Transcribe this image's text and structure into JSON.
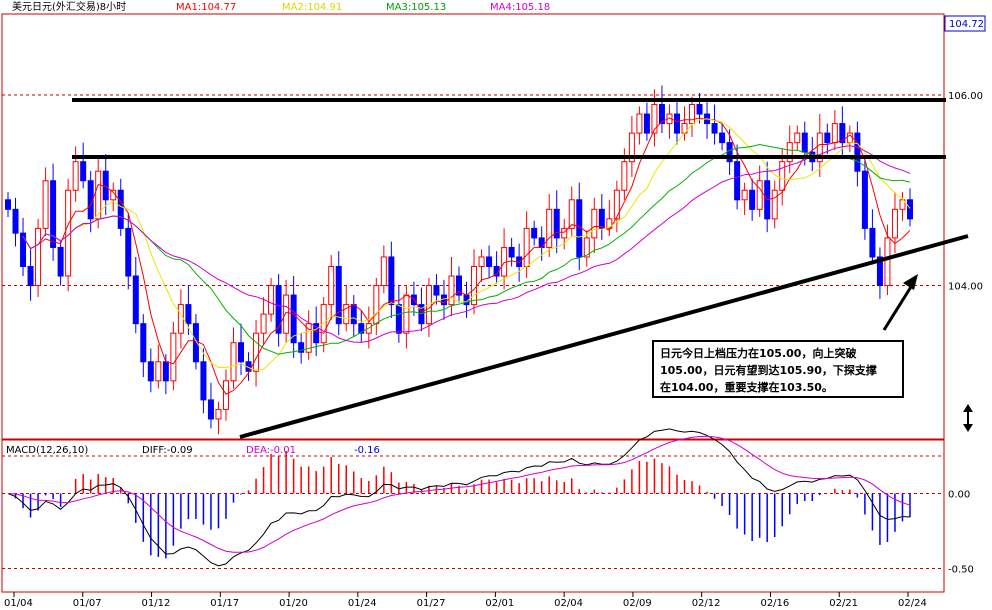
{
  "header": {
    "title": "美元日元(外汇交易)8小时",
    "ma": [
      {
        "label": "MA1:104.77",
        "color": "#ff0000"
      },
      {
        "label": "MA2:104.91",
        "color": "#e8e800"
      },
      {
        "label": "MA3:105.13",
        "color": "#00b000"
      },
      {
        "label": "MA4:105.18",
        "color": "#d000d0"
      }
    ]
  },
  "macd_header": {
    "name": "MACD(12,26,10)",
    "diff": "DIFF:-0.09",
    "dea": "DEA:-0.01",
    "macd": "-0.16"
  },
  "price_axis": {
    "current": "104.72",
    "labels": [
      {
        "text": "106.00",
        "value": 106.0
      },
      {
        "text": "104.00",
        "value": 104.0
      }
    ]
  },
  "macd_axis": {
    "labels": [
      {
        "text": "0.00",
        "value": 0.0
      },
      {
        "text": "-0.50",
        "value": -0.5
      }
    ]
  },
  "x_axis": {
    "labels": [
      "01/04",
      "01/07",
      "01/12",
      "01/17",
      "01/20",
      "01/24",
      "01/27",
      "02/01",
      "02/04",
      "02/09",
      "02/12",
      "02/16",
      "02/21",
      "02/24"
    ]
  },
  "annotation": {
    "lines": [
      "日元今日上档压力在105.00，向上突破",
      "105.00，日元有望到达105.90，下探支撑",
      "在104.00，重要支撑在103.50。"
    ]
  },
  "colors": {
    "up": "#ff0000",
    "down": "#0000ff",
    "ma1": "#ff0000",
    "ma2": "#e8e800",
    "ma3": "#00b000",
    "ma4": "#d000d0",
    "diff": "#000000",
    "dea": "#d000d0",
    "grid": "#cc0000"
  },
  "chart_data": {
    "type": "candlestick",
    "price_range": [
      102.4,
      106.85
    ],
    "macd_range": [
      -0.65,
      0.35
    ],
    "resistance_levels": [
      106.0,
      105.1
    ],
    "support_trendline": {
      "from": 102.4,
      "to": 104.1
    },
    "price_path": [
      104.8,
      104.55,
      104.2,
      104.0,
      104.6,
      105.1,
      104.4,
      104.1,
      105.0,
      105.3,
      105.1,
      104.7,
      105.2,
      104.9,
      105.0,
      104.6,
      104.1,
      103.6,
      103.2,
      103.0,
      103.2,
      103.0,
      103.5,
      103.8,
      103.6,
      103.2,
      102.8,
      102.6,
      102.7,
      103.0,
      103.4,
      103.2,
      103.1,
      103.5,
      103.7,
      104.0,
      103.5,
      103.9,
      103.4,
      103.3,
      103.6,
      103.4,
      103.8,
      104.2,
      103.6,
      103.8,
      103.6,
      103.5,
      103.6,
      104.0,
      104.3,
      103.8,
      103.5,
      103.9,
      103.8,
      103.6,
      104.0,
      103.9,
      103.8,
      104.1,
      103.9,
      103.8,
      104.2,
      104.3,
      104.2,
      104.1,
      104.4,
      104.3,
      104.2,
      104.6,
      104.5,
      104.4,
      104.8,
      104.5,
      104.6,
      104.9,
      104.3,
      104.5,
      104.8,
      104.6,
      104.7,
      105.0,
      105.3,
      105.6,
      105.8,
      105.6,
      105.9,
      105.7,
      105.8,
      105.6,
      105.7,
      105.9,
      105.8,
      105.7,
      105.6,
      105.5,
      105.3,
      104.9,
      105.0,
      104.8,
      105.1,
      104.7,
      105.0,
      105.3,
      105.5,
      105.6,
      105.4,
      105.3,
      105.6,
      105.5,
      105.7,
      105.5,
      105.6,
      105.2,
      104.6,
      104.3,
      104.0,
      104.5,
      104.8,
      104.9,
      104.7
    ],
    "ma_periods": [
      5,
      10,
      20,
      30
    ],
    "last": {
      "ma1": 104.77,
      "ma2": 104.91,
      "ma3": 105.13,
      "ma4": 105.18,
      "diff": -0.09,
      "dea": -0.01,
      "macd": -0.16
    }
  }
}
